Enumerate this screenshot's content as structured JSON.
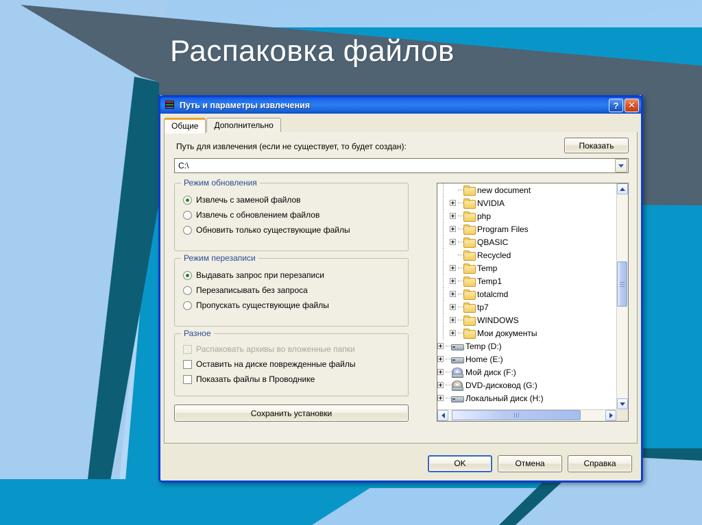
{
  "slide": {
    "title": "Распаковка файлов",
    "colors": {
      "light_blue": "#a5cdf0",
      "teal": "#0896c8",
      "dark_teal": "#0d5d75",
      "slate": "#4f6373",
      "title_text": "#ffffff"
    }
  },
  "dialog": {
    "titlebar": {
      "title": "Путь и параметры извлечения",
      "icon": "winrar-books-icon",
      "help_label": "?",
      "close_label": "✕",
      "gradient_start": "#1157d8",
      "gradient_end": "#0f4cc4"
    },
    "tabs": [
      {
        "label": "Общие",
        "active": true
      },
      {
        "label": "Дополнительно",
        "active": false
      }
    ],
    "path": {
      "label": "Путь для извлечения (если не существует, то будет создан):",
      "value": "C:\\",
      "show_button": "Показать"
    },
    "groups": {
      "update_mode": {
        "title": "Режим обновления",
        "options": [
          {
            "label": "Извлечь с заменой файлов",
            "selected": true
          },
          {
            "label": "Извлечь с обновлением файлов",
            "selected": false
          },
          {
            "label": "Обновить только существующие файлы",
            "selected": false
          }
        ]
      },
      "overwrite_mode": {
        "title": "Режим перезаписи",
        "options": [
          {
            "label": "Выдавать запрос при перезаписи",
            "selected": true
          },
          {
            "label": "Перезаписывать без запроса",
            "selected": false
          },
          {
            "label": "Пропускать существующие файлы",
            "selected": false
          }
        ]
      },
      "misc": {
        "title": "Разное",
        "options": [
          {
            "label": "Распаковать архивы во вложенные папки",
            "checked": false,
            "disabled": true
          },
          {
            "label": "Оставить на диске поврежденные файлы",
            "checked": false,
            "disabled": false
          },
          {
            "label": "Показать файлы в Проводнике",
            "checked": false,
            "disabled": false
          }
        ]
      }
    },
    "save_settings_button": "Сохранить установки",
    "tree": {
      "items": [
        {
          "label": "new document",
          "icon": "folder-icon",
          "level": 2,
          "expandable": false
        },
        {
          "label": "NVIDIA",
          "icon": "folder-icon",
          "level": 2,
          "expandable": true
        },
        {
          "label": "php",
          "icon": "folder-icon",
          "level": 2,
          "expandable": true
        },
        {
          "label": "Program Files",
          "icon": "folder-icon",
          "level": 2,
          "expandable": true
        },
        {
          "label": "QBASIC",
          "icon": "folder-icon",
          "level": 2,
          "expandable": true
        },
        {
          "label": "Recycled",
          "icon": "folder-icon",
          "level": 2,
          "expandable": false
        },
        {
          "label": "Temp",
          "icon": "folder-icon",
          "level": 2,
          "expandable": true
        },
        {
          "label": "Temp1",
          "icon": "folder-icon",
          "level": 2,
          "expandable": true
        },
        {
          "label": "totalcmd",
          "icon": "folder-icon",
          "level": 2,
          "expandable": true
        },
        {
          "label": "tp7",
          "icon": "folder-icon",
          "level": 2,
          "expandable": true
        },
        {
          "label": "WINDOWS",
          "icon": "folder-icon",
          "level": 2,
          "expandable": true
        },
        {
          "label": "Мои документы",
          "icon": "folder-icon",
          "level": 2,
          "expandable": true
        },
        {
          "label": "Temp (D:)",
          "icon": "hard-drive-icon",
          "level": 1,
          "expandable": true
        },
        {
          "label": "Home (E:)",
          "icon": "hard-drive-icon",
          "level": 1,
          "expandable": true
        },
        {
          "label": "Мой диск (F:)",
          "icon": "cd-drive-icon",
          "level": 1,
          "expandable": true
        },
        {
          "label": "DVD-дисковод (G:)",
          "icon": "dvd-drive-icon",
          "level": 1,
          "expandable": true
        },
        {
          "label": "Локальный диск (H:)",
          "icon": "hard-drive-icon",
          "level": 1,
          "expandable": true
        }
      ],
      "vscroll": {
        "thumb_top_pct": 33,
        "thumb_height_pct": 22
      },
      "hscroll": {
        "thumb_left_pct": 2,
        "thumb_width_pct": 82
      }
    },
    "footer_buttons": [
      {
        "label": "OK",
        "default": true
      },
      {
        "label": "Отмена",
        "default": false
      },
      {
        "label": "Справка",
        "default": false
      }
    ]
  }
}
